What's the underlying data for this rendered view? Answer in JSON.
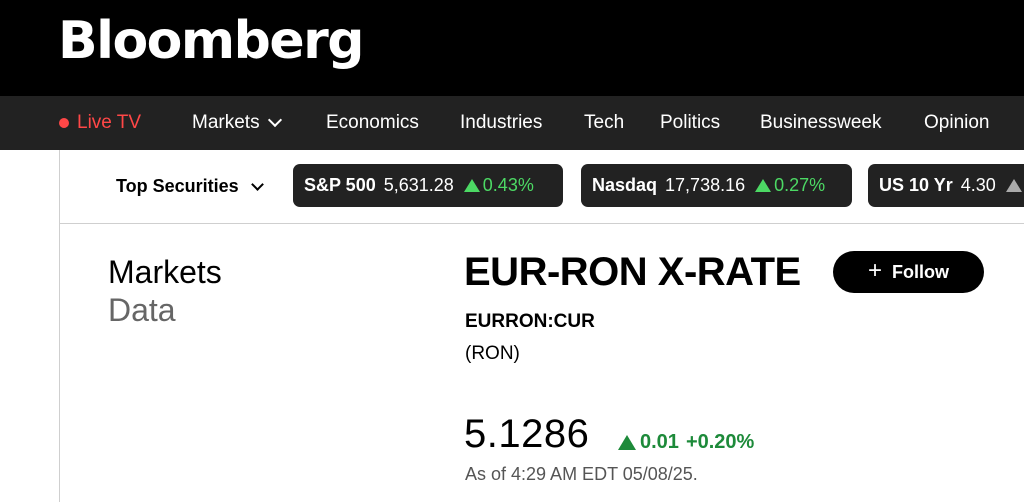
{
  "header": {
    "logo_text": "Bloomberg"
  },
  "nav": {
    "live_tv": "Live TV",
    "items": [
      "Markets",
      "Economics",
      "Industries",
      "Tech",
      "Politics",
      "Businessweek",
      "Opinion"
    ]
  },
  "securities": {
    "label": "Top Securities",
    "tickers": [
      {
        "name": "S&P 500",
        "value": "5,631.28",
        "change": "0.43%"
      },
      {
        "name": "Nasdaq",
        "value": "17,738.16",
        "change": "0.27%"
      },
      {
        "name": "US 10 Yr",
        "value": "4.30"
      }
    ]
  },
  "section": {
    "line1": "Markets",
    "line2": "Data"
  },
  "quote": {
    "title": "EUR-RON X-RATE",
    "follow_label": "Follow",
    "code": "EURRON:CUR",
    "currency": "(RON)",
    "price": "5.1286",
    "change_abs": "0.01",
    "change_pct": "+0.20%",
    "as_of": "As of 4:29 AM EDT 05/08/25."
  },
  "colors": {
    "live_red": "#ff4747",
    "positive_green": "#1d8a3a",
    "ticker_green": "#4cd964",
    "nav_bg": "#222222"
  },
  "icons": [
    "live-dot-icon",
    "chevron-down-icon",
    "up-arrow-icon",
    "plus-icon"
  ]
}
